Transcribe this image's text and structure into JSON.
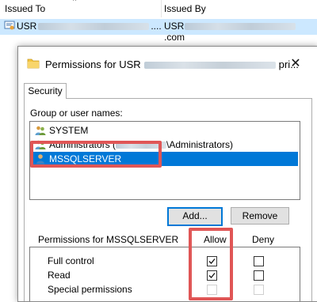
{
  "cert_list": {
    "col_issued_to": "Issued To",
    "col_issued_by": "Issued By",
    "row_issued_to": "USR",
    "row_issued_to_suffix": "....",
    "row_issued_by": "USR",
    "row_issued_by_suffix": ".com"
  },
  "dialog": {
    "title_prefix": "Permissions for USR",
    "title_suffix": "pri...",
    "close_glyph": "✕",
    "tab_security": "Security",
    "group_label": "Group or user names:",
    "principals": [
      {
        "label": "SYSTEM",
        "icon": "user-group-icon",
        "selected": false
      },
      {
        "label": "Administrators (",
        "label_tail": "\\Administrators)",
        "icon": "user-group-icon",
        "selected": false
      },
      {
        "label": "MSSQLSERVER",
        "icon": "user-icon",
        "selected": true
      }
    ],
    "add_button": "Add...",
    "remove_button": "Remove",
    "permissions_label": "Permissions for MSSQLSERVER",
    "allow_header": "Allow",
    "deny_header": "Deny",
    "permissions": [
      {
        "name": "Full control",
        "allow": true,
        "deny": false,
        "allow_disabled": false
      },
      {
        "name": "Read",
        "allow": true,
        "deny": false,
        "allow_disabled": false
      },
      {
        "name": "Special permissions",
        "allow": false,
        "deny": false,
        "allow_disabled": true
      }
    ]
  },
  "colors": {
    "selection": "#0078d7",
    "highlight": "#e05656",
    "row_selected": "#cce8ff"
  }
}
